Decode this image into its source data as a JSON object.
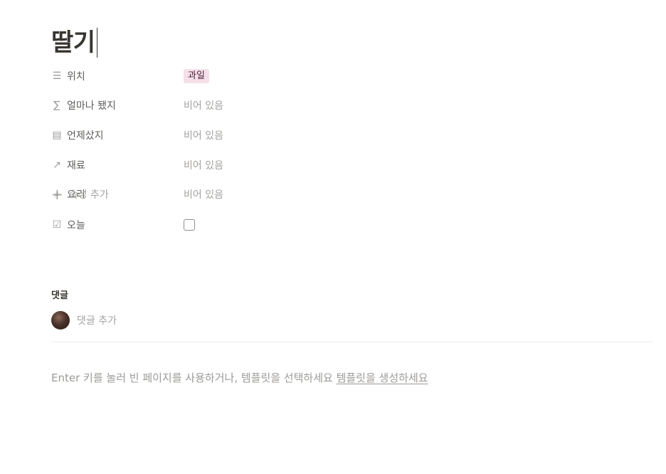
{
  "page": {
    "title": "딸기"
  },
  "properties": [
    {
      "icon": "list-icon",
      "glyph": "☰",
      "label": "위치",
      "value": "과일",
      "type": "tag",
      "tag_color": "#f5e0e9"
    },
    {
      "icon": "sigma-icon",
      "glyph": "∑",
      "label": "얼마나 됐지",
      "value": "비어 있음",
      "type": "empty"
    },
    {
      "icon": "calendar-icon",
      "glyph": "▤",
      "label": "언제샀지",
      "value": "비어 있음",
      "type": "empty"
    },
    {
      "icon": "relation-arrow-icon",
      "glyph": "↗",
      "label": "재료",
      "value": "비어 있음",
      "type": "empty"
    },
    {
      "icon": "search-icon",
      "glyph": "⌕",
      "label": "요리",
      "value": "비어 있음",
      "type": "empty"
    },
    {
      "icon": "checkbox-icon",
      "glyph": "☑",
      "label": "오늘",
      "value": "",
      "type": "checkbox",
      "checked": false
    }
  ],
  "add_property": {
    "label": "속성 추가"
  },
  "comments": {
    "heading": "댓글",
    "add_label": "댓글 추가"
  },
  "footer": {
    "hint_text": "Enter 키를 눌러 빈 페이지를 사용하거나, 템플릿을 선택하세요 ",
    "hint_link": "템플릿을 생성하세요"
  }
}
